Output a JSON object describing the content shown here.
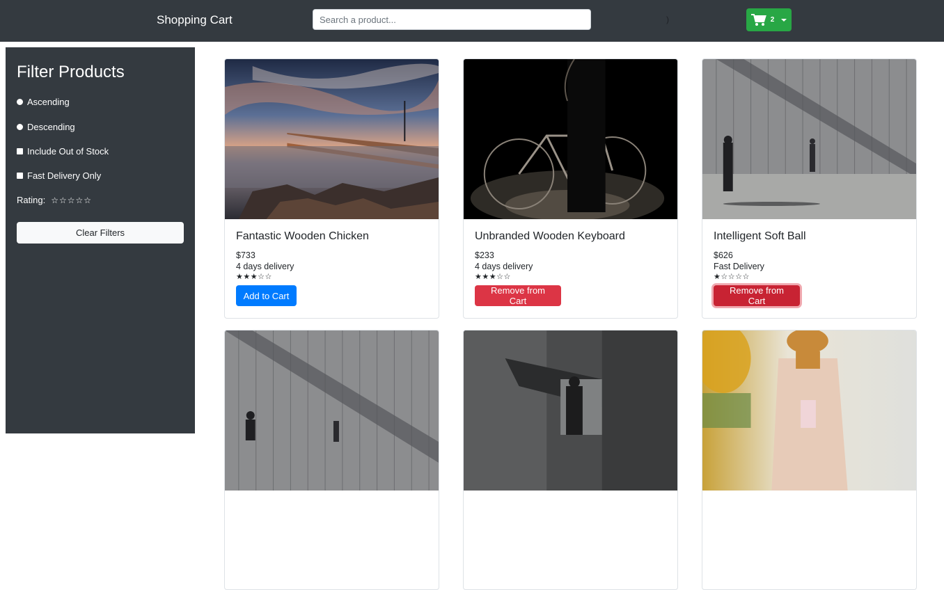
{
  "header": {
    "brand": "Shopping Cart",
    "search_placeholder": "Search a product...",
    "stray_text": ")",
    "cart_count": "2",
    "cart_color": "#28a745"
  },
  "sidebar": {
    "title": "Filter Products",
    "options": [
      {
        "type": "radio",
        "label": "Ascending"
      },
      {
        "type": "radio",
        "label": "Descending"
      },
      {
        "type": "checkbox",
        "label": "Include Out of Stock"
      },
      {
        "type": "checkbox",
        "label": "Fast Delivery Only"
      }
    ],
    "rating_label": "Rating:",
    "rating_stars": "☆☆☆☆☆",
    "clear_label": "Clear Filters"
  },
  "products": [
    {
      "name": "Fantastic Wooden Chicken",
      "price": "$733",
      "delivery": "4 days delivery",
      "rating": 3,
      "stars": "★★★☆☆",
      "button": "Add to Cart",
      "button_kind": "add",
      "image": "pier-sunset"
    },
    {
      "name": "Unbranded Wooden Keyboard",
      "price": "$233",
      "delivery": "4 days delivery",
      "rating": 3,
      "stars": "★★★☆☆",
      "button": "Remove from Cart",
      "button_kind": "remove",
      "image": "bicycle-silhouette"
    },
    {
      "name": "Intelligent Soft Ball",
      "price": "$626",
      "delivery": "Fast Delivery",
      "rating": 1,
      "stars": "★☆☆☆☆",
      "button": "Remove from Cart",
      "button_kind": "remove",
      "image": "people-walking-wall"
    },
    {
      "image": "people-walking-wall"
    },
    {
      "image": "concrete-figure"
    },
    {
      "image": "woman-scarf-autumn"
    }
  ],
  "colors": {
    "navbar": "#343a40",
    "primary": "#007bff",
    "danger": "#dc3545",
    "success": "#28a745"
  }
}
